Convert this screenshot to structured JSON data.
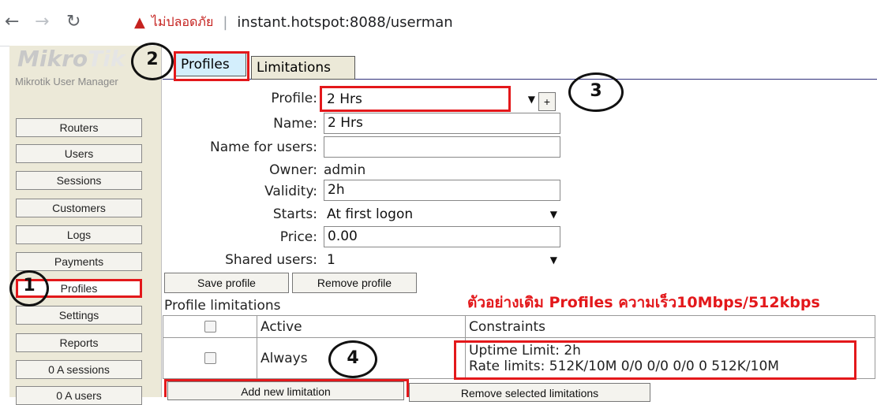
{
  "browser": {
    "back_icon": "arrow-left-icon",
    "forward_icon": "arrow-right-icon",
    "reload_icon": "reload-icon",
    "security_label": "ไม่ปลอดภัย",
    "url": "instant.hotspot:8088/userman"
  },
  "sidebar": {
    "logo": "MikroTik",
    "logo_sub": "Mikrotik User Manager",
    "items": [
      "Routers",
      "Users",
      "Sessions",
      "Customers",
      "Logs",
      "Payments",
      "Profiles",
      "Settings",
      "Reports",
      "0 A sessions",
      "0 A users"
    ],
    "active": "Profiles"
  },
  "tabs": {
    "profiles": "Profiles",
    "limitations": "Limitations"
  },
  "form": {
    "profile_label": "Profile:",
    "profile_value": "2 Hrs",
    "add_label": "+",
    "name_label": "Name:",
    "name_value": "2 Hrs",
    "name_users_label": "Name for users:",
    "name_users_value": "",
    "owner_label": "Owner:",
    "owner_value": "admin",
    "validity_label": "Validity:",
    "validity_value": "2h",
    "starts_label": "Starts:",
    "starts_value": "At first logon",
    "price_label": "Price:",
    "price_value": "0.00",
    "shared_label": "Shared users:",
    "shared_value": "1"
  },
  "buttons": {
    "save": "Save profile",
    "remove": "Remove profile",
    "add_limit": "Add new limitation",
    "remove_limits": "Remove selected limitations"
  },
  "limitations": {
    "title": "Profile limitations",
    "headers": [
      "Active",
      "Constraints"
    ],
    "rows": [
      {
        "active": "Always",
        "uptime": "Uptime Limit: 2h",
        "rate": "Rate limits: 512K/10M 0/0 0/0 0/0 0 512K/10M"
      }
    ]
  },
  "annotation_text": "ตัวอย่างเดิม Profiles ความเร็ว10Mbps/512kbps",
  "steps": [
    "1",
    "2",
    "3",
    "4"
  ],
  "colors": {
    "highlight": "#e3181b",
    "tab_active": "#d3eefc",
    "sidebar_bg": "#ece9d8"
  }
}
